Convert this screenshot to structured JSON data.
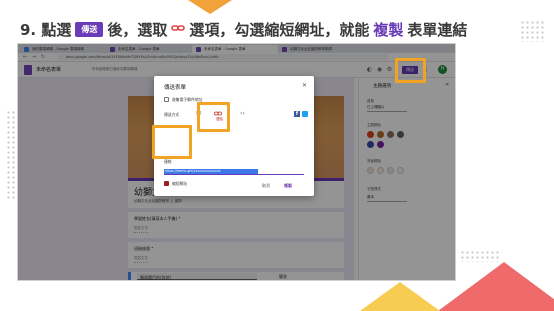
{
  "slide": {
    "step_prefix": "9. 點選",
    "send_chip": "傳送",
    "after_send": "後，選取",
    "link_icon": "link-icon",
    "after_link": "選項，勾選縮短網址，就能",
    "highlight": "複製",
    "tail": "表單連結"
  },
  "browser": {
    "tabs": [
      {
        "label": "我的雲端硬碟 - Google 雲端硬碟"
      },
      {
        "label": "未命名表單 - Google 表單"
      },
      {
        "label": "未命名表單 - Google 表單"
      },
      {
        "label": "幼獅文化全民國防教育題庫"
      }
    ],
    "url": "docs.google.com/forms/d/1YF0tNxMnTQ8YPaLGmUmuWc0H2QmtbxyZLyVNeDcrcL/edit"
  },
  "forms_app": {
    "form_name": "未命名表單",
    "save_status": "所有變更都已儲存到雲端硬碟",
    "send_button": "傳送",
    "avatar_letter": "H",
    "form_title": "幼獅文化全民國防教育題庫",
    "form_description": "幼獅文化全民國防教育 上 國庫",
    "questions": [
      {
        "title": "學號姓名(填寫本人手機) *",
        "answer": "簡答文字"
      },
      {
        "title": "班級座號 *",
        "answer": "簡答文字"
      }
    ],
    "active_question": {
      "input": "簡易題目的(其他)",
      "type": "簡答",
      "answer": "簡答文字"
    }
  },
  "theme_panel": {
    "title": "主題選項",
    "header_label": "頁首",
    "header_select": "已上傳圖片",
    "theme_color_label": "主題顏色",
    "bg_color_label": "背景顏色",
    "font_label": "字型樣式",
    "font_select": "基本",
    "colors": {
      "theme": [
        "#d84315",
        "#b26a2a",
        "#8d6e63",
        "#5f6368",
        "#3949ab",
        "#7b1fa2"
      ],
      "background": [
        "#f9e0d4",
        "#fbe9e7",
        "#ede7f6",
        "#f5f5f5"
      ]
    }
  },
  "dialog": {
    "title": "傳送表單",
    "collect_email": "收集電子郵件地址",
    "send_via_label": "傳送方式",
    "email_icon": "email-icon",
    "link_icon": "link-icon",
    "embed_icon": "embed-code-icon",
    "link_tab_label": "連結",
    "facebook_icon": "facebook-icon",
    "twitter_icon": "twitter-icon",
    "link_section_label": "連結",
    "link_value": "https://forms.gle/xxxxxxxxxxxxxx",
    "shorten_label": "縮短網址",
    "cancel": "取消",
    "copy": "複製",
    "close_icon": "close-icon"
  },
  "colors": {
    "accent_purple": "#673ab7",
    "highlight_orange": "#f0a325",
    "title_highlight": "#6a3bb6"
  }
}
